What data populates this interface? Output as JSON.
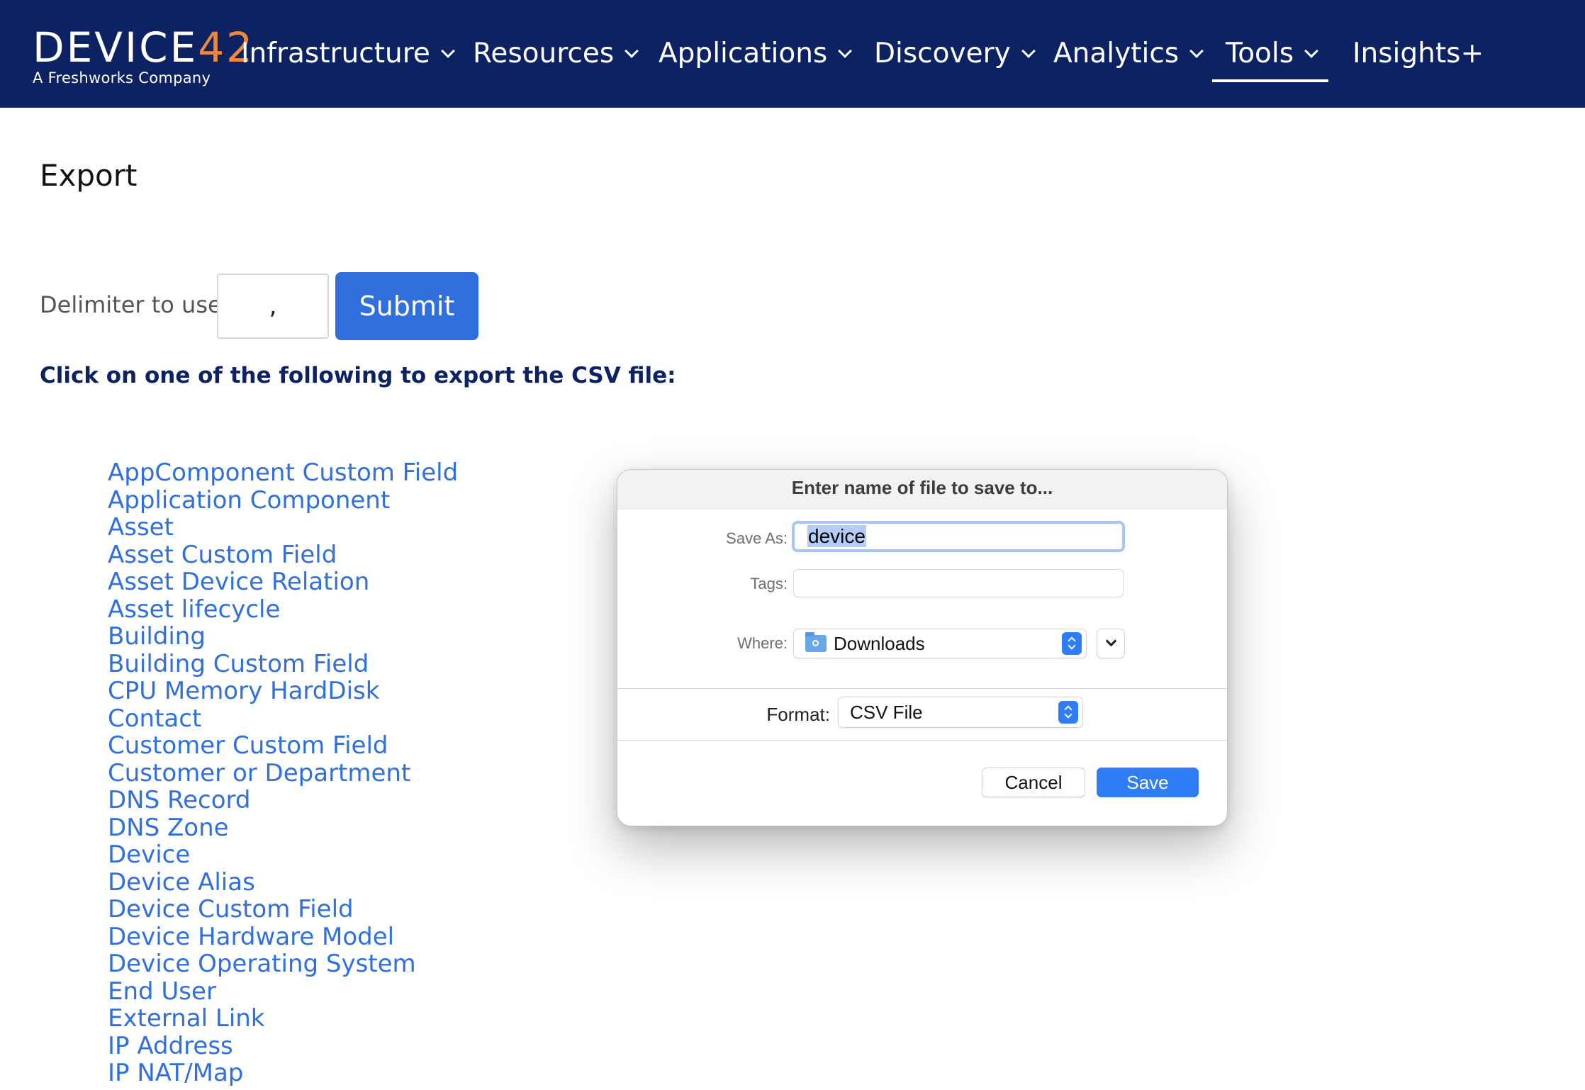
{
  "logo": {
    "name_part1": "DEVICE",
    "name_part2": "42",
    "tagline": "A Freshworks Company"
  },
  "nav": {
    "items": [
      {
        "label": "Infrastructure",
        "has_menu": true
      },
      {
        "label": "Resources",
        "has_menu": true
      },
      {
        "label": "Applications",
        "has_menu": true
      },
      {
        "label": "Discovery",
        "has_menu": true
      },
      {
        "label": "Analytics",
        "has_menu": true
      },
      {
        "label": "Tools",
        "has_menu": true,
        "active": true
      },
      {
        "label": "Insights+",
        "has_menu": false
      }
    ]
  },
  "page": {
    "title": "Export",
    "delimiter_label": "Delimiter to use:",
    "delimiter_value": ",",
    "submit_label": "Submit",
    "instructions": "Click on one of the following to export the CSV file:"
  },
  "export_links": [
    "AppComponent Custom Field",
    "Application Component",
    "Asset",
    "Asset Custom Field",
    "Asset Device Relation",
    "Asset lifecycle",
    "Building",
    "Building Custom Field",
    "CPU Memory HardDisk",
    "Contact",
    "Customer Custom Field",
    "Customer or Department",
    "DNS Record",
    "DNS Zone",
    "Device",
    "Device Alias",
    "Device Custom Field",
    "Device Hardware Model",
    "Device Operating System",
    "End User",
    "External Link",
    "IP Address",
    "IP NAT/Map"
  ],
  "dialog": {
    "title": "Enter name of file to save to...",
    "save_as_label": "Save As:",
    "save_as_value": "device",
    "tags_label": "Tags:",
    "where_label": "Where:",
    "where_value": "Downloads",
    "format_label": "Format:",
    "format_value": "CSV File",
    "cancel_label": "Cancel",
    "save_label": "Save"
  },
  "colors": {
    "nav_bg": "#0c2263",
    "accent": "#2f6fde",
    "logo_accent": "#f0883a",
    "dialog_primary": "#2f7df5"
  }
}
